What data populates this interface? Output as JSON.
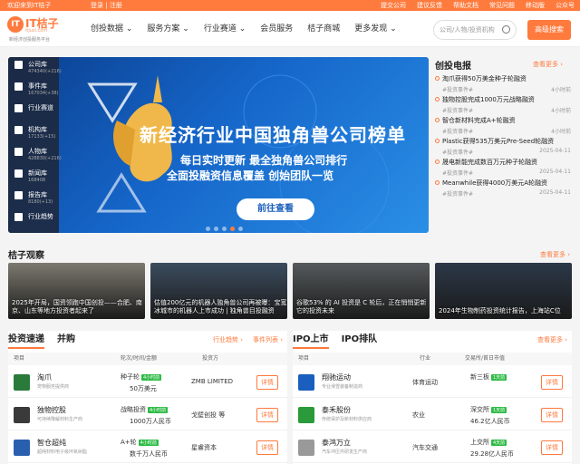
{
  "topbar": {
    "welcome": "欢迎来到IT桔子",
    "login": "登录",
    "register": "注册",
    "links": [
      "提交公司",
      "建议反馈",
      "帮助文档",
      "常见问题",
      "移动版",
      "公众号"
    ]
  },
  "logo": {
    "mark": "IT",
    "name": "IT桔子",
    "sub": "itjuzi.com",
    "slogan": "新经济创投服务平台"
  },
  "nav": {
    "items": [
      "创投数据",
      "服务方案",
      "行业赛道",
      "会员服务",
      "桔子商城",
      "更多发现"
    ],
    "search_placeholder": "公司/人物/投资机构",
    "advanced": "高级搜索"
  },
  "banner": {
    "side": [
      {
        "label": "公司库",
        "count": "474340(+216)"
      },
      {
        "label": "事件库",
        "count": "167034(+38)"
      },
      {
        "label": "行业赛道",
        "count": ""
      },
      {
        "label": "机构库",
        "count": "17133(+15)"
      },
      {
        "label": "人物库",
        "count": "428830(+216)"
      },
      {
        "label": "新闻库",
        "count": "168408"
      },
      {
        "label": "报告库",
        "count": "8180(+13)"
      },
      {
        "label": "行业趋势",
        "count": ""
      }
    ],
    "title": "新经济行业中国独角兽公司榜单",
    "sub1": "每日实时更新 最全独角兽公司排行",
    "sub2": "全面投融资信息覆盖 创始团队一览",
    "button": "前往查看"
  },
  "news": {
    "title": "创投电报",
    "more": "查看更多 ›",
    "items": [
      {
        "t": "淘爪获得50万美金种子轮融资",
        "tag": "#投资事件#",
        "tm": "4小时前"
      },
      {
        "t": "独物控股完成1000万元战略融资",
        "tag": "#投资事件#",
        "tm": "4小时前"
      },
      {
        "t": "智仓新材料完成A+轮融资",
        "tag": "#投资事件#",
        "tm": "4小时前"
      },
      {
        "t": "Plastic获得535万美元Pre-Seed轮融资",
        "tag": "#投资事件#",
        "tm": "2025-04-11"
      },
      {
        "t": "晟电新能完成数百万元种子轮融资",
        "tag": "#投资事件#",
        "tm": "2025-04-11"
      },
      {
        "t": "Meanwhile获得4000万美元A轮融资",
        "tag": "#投资事件#",
        "tm": "2025-04-11"
      }
    ]
  },
  "observe": {
    "title": "桔子观察",
    "more": "查看更多 ›",
    "cards": [
      {
        "cap": "2025年开局，国资领跑中国创投——合肥、南京、山东等地方投资者起来了",
        "color": "#7c7a6f"
      },
      {
        "cap": "估值200亿元的机器人独角兽公司再被曝：宝宽冰城市的机器人上市成功 | 独角兽目投融资",
        "color": "#3b4c5e"
      },
      {
        "cap": "谷歌53% 的 AI 投资是 C 轮后，正在悄悄更新它的投资未来",
        "color": "#555a5c"
      },
      {
        "cap": "2024年生物制药投资统计报告，上海站C位",
        "color": "#2c3848"
      }
    ]
  },
  "invest": {
    "tabs": [
      "投资速递",
      "并购"
    ],
    "trend": "行业趋势 ›",
    "more": "事件列表 ›",
    "headers": [
      "项目",
      "轮次/时间/金额",
      "投资方"
    ],
    "rows": [
      {
        "name": "淘爪",
        "desc": "宠物服务提供商",
        "round": "种子轮",
        "tag": "4小时前",
        "amount": "50万美元",
        "investor": "ZMB LIMITED",
        "logo": "#2a7a3a",
        "det": "详情"
      },
      {
        "name": "独物控股",
        "desc": "可持续降解材料生产商",
        "round": "战略投资",
        "tag": "4小时前",
        "amount": "1000万人民币",
        "investor": "戈壁创投 等",
        "logo": "#3a3a3a",
        "det": "详情"
      },
      {
        "name": "智仓超纯",
        "desc": "超纯材料电子级环氧树脂",
        "round": "A+轮",
        "tag": "4小时前",
        "amount": "数千万人民币",
        "investor": "星睿资本",
        "logo": "#2a5fb0",
        "det": "详情"
      }
    ]
  },
  "ipo": {
    "tabs": [
      "IPO上市",
      "IPO排队"
    ],
    "more": "查看更多 ›",
    "headers": [
      "项目",
      "行业",
      "交易所/首日市值"
    ],
    "rows": [
      {
        "name": "翔驰运动",
        "desc": "专业滑雪装备制造商",
        "industry": "体育运动",
        "exch": "新三板",
        "tag": "1天前",
        "cap": "",
        "logo": "#1a5fbd",
        "det": "详情"
      },
      {
        "name": "泰禾股份",
        "desc": "传统保护及新材料供应商",
        "industry": "农业",
        "exch": "深交所",
        "tag": "1天前",
        "cap": "46.2亿人民币",
        "logo": "#2a9a3a",
        "det": "详情"
      },
      {
        "name": "泰鸿万立",
        "desc": "汽车冲压件研发生产商",
        "industry": "汽车交通",
        "exch": "上交所",
        "tag": "4天前",
        "cap": "29.28亿人民币",
        "logo": "#999",
        "det": "详情"
      }
    ]
  }
}
